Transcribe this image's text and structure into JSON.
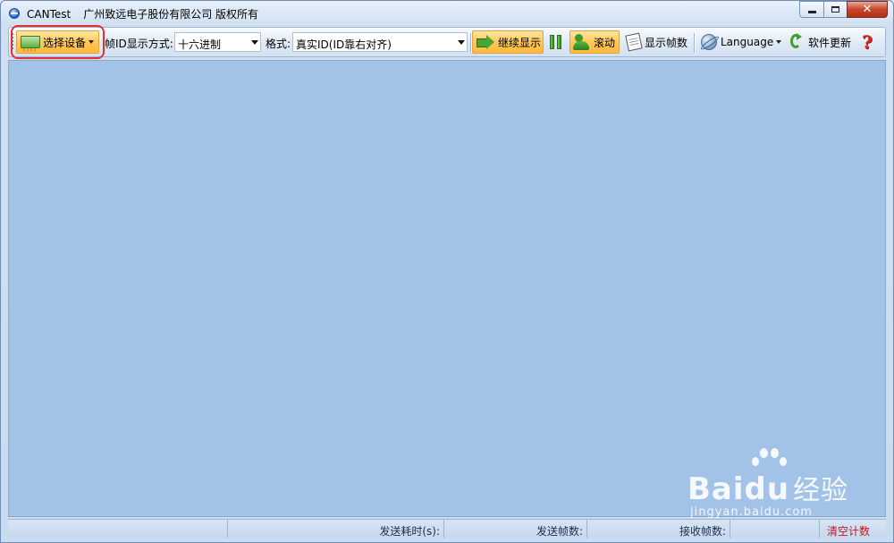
{
  "window": {
    "app_name": "CANTest",
    "company": "广州致远电子股份有限公司 版权所有",
    "controls": {
      "minimize": "–",
      "maximize": "□",
      "close": "✕"
    }
  },
  "toolbar": {
    "select_device": {
      "label": "选择设备",
      "icon": "interface-card-icon",
      "state": "hover-highlighted"
    },
    "frame_id_format": {
      "label": "帧ID显示方式:",
      "value": "十六进制"
    },
    "format": {
      "label": "格式:",
      "value": "真实ID(ID靠右对齐)"
    },
    "continue_display": {
      "label": "继续显示",
      "icon": "green-arrow-icon",
      "state": "pressed"
    },
    "pause": {
      "icon": "pause-icon"
    },
    "scroll": {
      "label": "滚动",
      "icon": "scroll-person-icon",
      "state": "pressed"
    },
    "show_frame_count": {
      "label": "显示帧数",
      "icon": "document-icon"
    },
    "language": {
      "label": "Language",
      "icon": "globe-icon"
    },
    "software_update": {
      "label": "软件更新",
      "icon": "refresh-icon"
    },
    "help": {
      "icon": "help-icon",
      "glyph": "?"
    }
  },
  "statusbar": {
    "send_time_label": "发送耗时(s):",
    "send_frames_label": "发送帧数:",
    "recv_frames_label": "接收帧数:",
    "clear_count": "清空计数"
  },
  "watermark": {
    "brand": "Bai",
    "brand_tail": "du",
    "brand_cn": "经验",
    "url": "jingyan.baidu.com"
  },
  "colors": {
    "client_area": "#a2c2e8",
    "hot_button": "#ffc85a",
    "highlight_outline": "#e23030",
    "clear_count_text": "#c01818"
  }
}
